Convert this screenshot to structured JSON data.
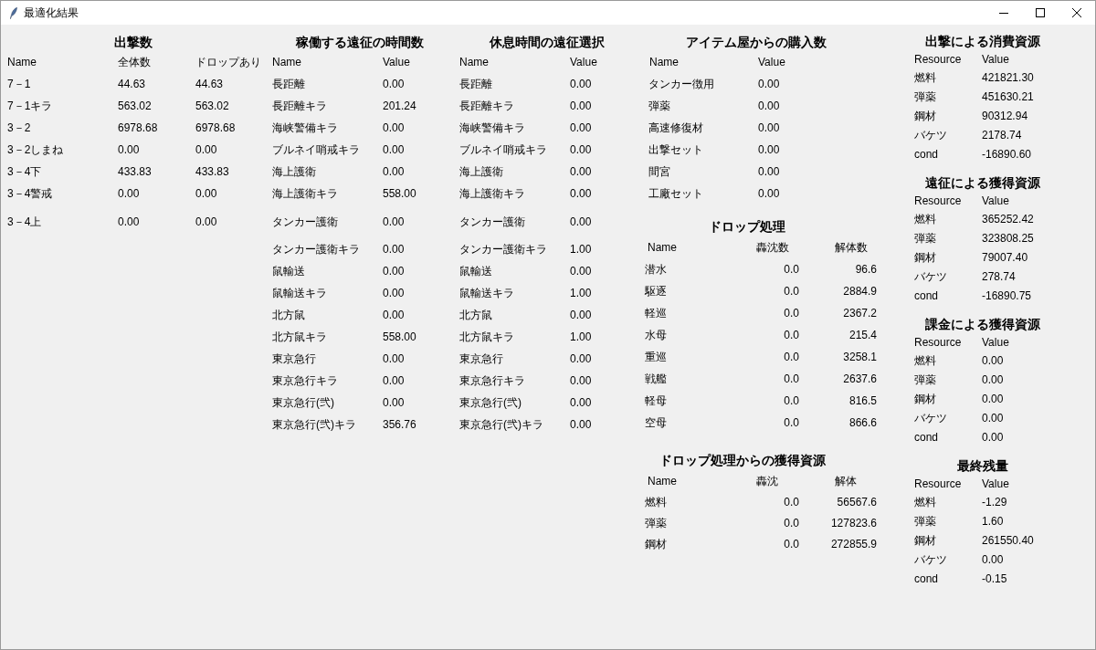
{
  "window": {
    "title": "最適化結果"
  },
  "sortie_counts": {
    "title": "出撃数",
    "columns": [
      "Name",
      "全体数",
      "ドロップあり"
    ],
    "rows": [
      [
        "7－1",
        "44.63",
        "44.63"
      ],
      [
        "7－1キラ",
        "563.02",
        "563.02"
      ],
      [
        "3－2",
        "6978.68",
        "6978.68"
      ],
      [
        "3－2しまね",
        "0.00",
        "0.00"
      ],
      [
        "3－4下",
        "433.83",
        "433.83"
      ],
      [
        "3－4警戒",
        "0.00",
        "0.00"
      ],
      [
        "3－4上",
        "0.00",
        "0.00"
      ]
    ]
  },
  "expedition_hours": {
    "title": "稼働する遠征の時間数",
    "columns": [
      "Name",
      "Value"
    ],
    "rows": [
      [
        "長距離",
        "0.00"
      ],
      [
        "長距離キラ",
        "201.24"
      ],
      [
        "海峡警備キラ",
        "0.00"
      ],
      [
        "ブルネイ哨戒キラ",
        "0.00"
      ],
      [
        "海上護衛",
        "0.00"
      ],
      [
        "海上護衛キラ",
        "558.00"
      ],
      [
        "タンカー護衛",
        "0.00"
      ],
      [
        "タンカー護衛キラ",
        "0.00"
      ],
      [
        "鼠輸送",
        "0.00"
      ],
      [
        "鼠輸送キラ",
        "0.00"
      ],
      [
        "北方鼠",
        "0.00"
      ],
      [
        "北方鼠キラ",
        "558.00"
      ],
      [
        "東京急行",
        "0.00"
      ],
      [
        "東京急行キラ",
        "0.00"
      ],
      [
        "東京急行(弐)",
        "0.00"
      ],
      [
        "東京急行(弐)キラ",
        "356.76"
      ]
    ]
  },
  "rest_expeditions": {
    "title": "休息時間の遠征選択",
    "columns": [
      "Name",
      "Value"
    ],
    "rows": [
      [
        "長距離",
        "0.00"
      ],
      [
        "長距離キラ",
        "0.00"
      ],
      [
        "海峡警備キラ",
        "0.00"
      ],
      [
        "ブルネイ哨戒キラ",
        "0.00"
      ],
      [
        "海上護衛",
        "0.00"
      ],
      [
        "海上護衛キラ",
        "0.00"
      ],
      [
        "タンカー護衛",
        "0.00"
      ],
      [
        "タンカー護衛キラ",
        "1.00"
      ],
      [
        "鼠輸送",
        "0.00"
      ],
      [
        "鼠輸送キラ",
        "1.00"
      ],
      [
        "北方鼠",
        "0.00"
      ],
      [
        "北方鼠キラ",
        "1.00"
      ],
      [
        "東京急行",
        "0.00"
      ],
      [
        "東京急行キラ",
        "0.00"
      ],
      [
        "東京急行(弐)",
        "0.00"
      ],
      [
        "東京急行(弐)キラ",
        "0.00"
      ]
    ]
  },
  "item_shop": {
    "title": "アイテム屋からの購入数",
    "columns": [
      "Name",
      "Value"
    ],
    "rows": [
      [
        "タンカー徴用",
        "0.00"
      ],
      [
        "弾薬",
        "0.00"
      ],
      [
        "高速修復材",
        "0.00"
      ],
      [
        "出撃セット",
        "0.00"
      ],
      [
        "間宮",
        "0.00"
      ],
      [
        "工廠セット",
        "0.00"
      ]
    ]
  },
  "drop_processing": {
    "title": "ドロップ処理",
    "columns": [
      "Name",
      "轟沈数",
      "解体数"
    ],
    "rows": [
      [
        "潜水",
        "0.0",
        "96.6"
      ],
      [
        "駆逐",
        "0.0",
        "2884.9"
      ],
      [
        "軽巡",
        "0.0",
        "2367.2"
      ],
      [
        "水母",
        "0.0",
        "215.4"
      ],
      [
        "重巡",
        "0.0",
        "3258.1"
      ],
      [
        "戦艦",
        "0.0",
        "2637.6"
      ],
      [
        "軽母",
        "0.0",
        "816.5"
      ],
      [
        "空母",
        "0.0",
        "866.6"
      ]
    ]
  },
  "drop_resources": {
    "title": "ドロップ処理からの獲得資源",
    "columns": [
      "Name",
      "轟沈",
      "解体"
    ],
    "rows": [
      [
        "燃料",
        "0.0",
        "56567.6"
      ],
      [
        "弾薬",
        "0.0",
        "127823.6"
      ],
      [
        "鋼材",
        "0.0",
        "272855.9"
      ]
    ]
  },
  "resource_sections": [
    {
      "title": "出撃による消費資源",
      "columns": [
        "Resource",
        "Value"
      ],
      "rows": [
        [
          "燃料",
          "421821.30"
        ],
        [
          "弾薬",
          "451630.21"
        ],
        [
          "鋼材",
          "90312.94"
        ],
        [
          "バケツ",
          "2178.74"
        ],
        [
          "cond",
          "-16890.60"
        ]
      ]
    },
    {
      "title": "遠征による獲得資源",
      "columns": [
        "Resource",
        "Value"
      ],
      "rows": [
        [
          "燃料",
          "365252.42"
        ],
        [
          "弾薬",
          "323808.25"
        ],
        [
          "鋼材",
          "79007.40"
        ],
        [
          "バケツ",
          "278.74"
        ],
        [
          "cond",
          "-16890.75"
        ]
      ]
    },
    {
      "title": "課金による獲得資源",
      "columns": [
        "Resource",
        "Value"
      ],
      "rows": [
        [
          "燃料",
          "0.00"
        ],
        [
          "弾薬",
          "0.00"
        ],
        [
          "鋼材",
          "0.00"
        ],
        [
          "バケツ",
          "0.00"
        ],
        [
          "cond",
          "0.00"
        ]
      ]
    },
    {
      "title": "最終残量",
      "columns": [
        "Resource",
        "Value"
      ],
      "rows": [
        [
          "燃料",
          "-1.29"
        ],
        [
          "弾薬",
          "1.60"
        ],
        [
          "鋼材",
          "261550.40"
        ],
        [
          "バケツ",
          "0.00"
        ],
        [
          "cond",
          "-0.15"
        ]
      ]
    }
  ]
}
